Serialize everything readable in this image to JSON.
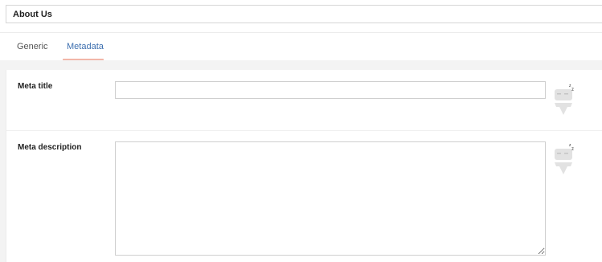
{
  "page": {
    "title": "About Us"
  },
  "tabs": [
    {
      "label": "Generic",
      "active": false
    },
    {
      "label": "Metadata",
      "active": true
    }
  ],
  "fields": {
    "meta_title": {
      "label": "Meta title",
      "value": ""
    },
    "meta_description": {
      "label": "Meta description",
      "value": ""
    }
  },
  "icons": {
    "status": "sleeping-robot-icon"
  },
  "colors": {
    "accent": "#3d6faf",
    "tab_underline": "#f2b6a8",
    "background": "#f3f3f3"
  }
}
